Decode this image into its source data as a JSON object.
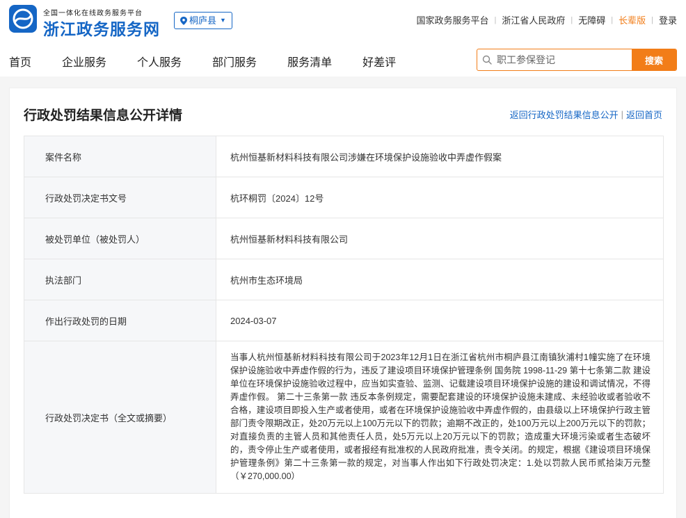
{
  "header": {
    "slogan": "全国一体化在线政务服务平台",
    "site_name": "浙江政务服务网",
    "region": "桐庐县",
    "links": [
      "国家政务服务平台",
      "浙江省人民政府",
      "无障碍",
      "长辈版",
      "登录"
    ],
    "nav": [
      "首页",
      "企业服务",
      "个人服务",
      "部门服务",
      "服务清单",
      "好差评"
    ],
    "search_placeholder": "职工参保登记",
    "search_button": "搜索"
  },
  "page": {
    "title": "行政处罚结果信息公开详情",
    "back_list": "返回行政处罚结果信息公开",
    "back_home": "返回首页"
  },
  "details": [
    {
      "label": "案件名称",
      "value": "杭州恒基新材料科技有限公司涉嫌在环境保护设施验收中弄虚作假案"
    },
    {
      "label": "行政处罚决定书文号",
      "value": "杭环桐罚〔2024〕12号"
    },
    {
      "label": "被处罚单位（被处罚人）",
      "value": "杭州恒基新材料科技有限公司"
    },
    {
      "label": "执法部门",
      "value": "杭州市生态环境局"
    },
    {
      "label": "作出行政处罚的日期",
      "value": "2024-03-07"
    },
    {
      "label": "行政处罚决定书（全文或摘要）",
      "value": "当事人杭州恒基新材料科技有限公司于2023年12月1日在浙江省杭州市桐庐县江南镇狄浦村1幢实施了在环境保护设施验收中弄虚作假的行为，违反了建设项目环境保护管理条例 国务院 1998-11-29 第十七条第二款 建设单位在环境保护设施验收过程中，应当如实查验、监测、记载建设项目环境保护设施的建设和调试情况，不得弄虚作假。 第二十三条第一款 违反本条例规定，需要配套建设的环境保护设施未建成、未经验收或者验收不合格，建设项目即投入生产或者使用，或者在环境保护设施验收中弄虚作假的，由县级以上环境保护行政主管部门责令限期改正，处20万元以上100万元以下的罚款；逾期不改正的，处100万元以上200万元以下的罚款；对直接负责的主管人员和其他责任人员，处5万元以上20万元以下的罚款；造成重大环境污染或者生态破坏的，责令停止生产或者使用，或者报经有批准权的人民政府批准，责令关闭。的规定，根据《建设项目环境保护管理条例》第二十三条第一款的规定，对当事人作出如下行政处罚决定：1.处以罚款人民币贰拾柒万元整（￥270,000.00）"
    }
  ]
}
